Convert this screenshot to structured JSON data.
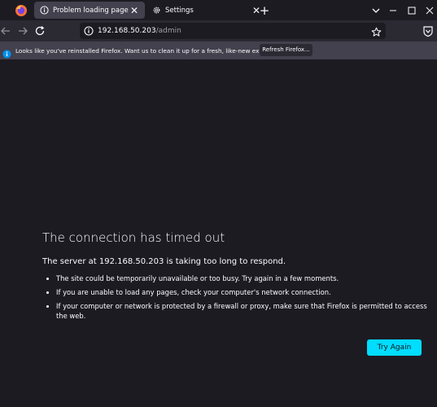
{
  "tabs": [
    {
      "title": "Problem loading page",
      "active": true
    },
    {
      "title": "Settings",
      "active": false
    }
  ],
  "urlbar": {
    "host": "192.168.50.203",
    "path": "/admin"
  },
  "notification": {
    "text": "Looks like you've reinstalled Firefox. Want us to clean it up for a fresh, like-new experience?",
    "button_label": "Refresh Firefox..."
  },
  "error": {
    "title": "The connection has timed out",
    "subtitle": "The server at 192.168.50.203 is taking too long to respond.",
    "items": [
      "The site could be temporarily unavailable or too busy. Try again in a few moments.",
      "If you are unable to load any pages, check your computer's network connection.",
      "If your computer or network is protected by a firewall or proxy, make sure that Firefox is permitted to access the web."
    ],
    "button_label": "Try Again"
  },
  "colors": {
    "page_bg": "#1c1b22",
    "toolbar_bg": "#2b2a33",
    "notification_bg": "#42414d",
    "accent": "#00ddff"
  }
}
